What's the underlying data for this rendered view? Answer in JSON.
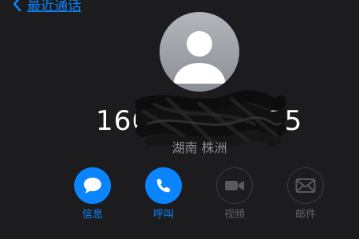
{
  "nav": {
    "back_label": "最近通话"
  },
  "contact": {
    "number_visible_prefix": "166",
    "number_visible_suffix": "85",
    "location": "湖南 株洲"
  },
  "actions": [
    {
      "label": "信息",
      "icon": "message-icon",
      "enabled": true
    },
    {
      "label": "呼叫",
      "icon": "phone-icon",
      "enabled": true
    },
    {
      "label": "视频",
      "icon": "video-icon",
      "enabled": false
    },
    {
      "label": "邮件",
      "icon": "mail-icon",
      "enabled": false
    }
  ],
  "colors": {
    "background": "#1c1c1e",
    "accent": "#0a84ff",
    "disabled": "#636366",
    "secondary_text": "#8e8e93"
  }
}
